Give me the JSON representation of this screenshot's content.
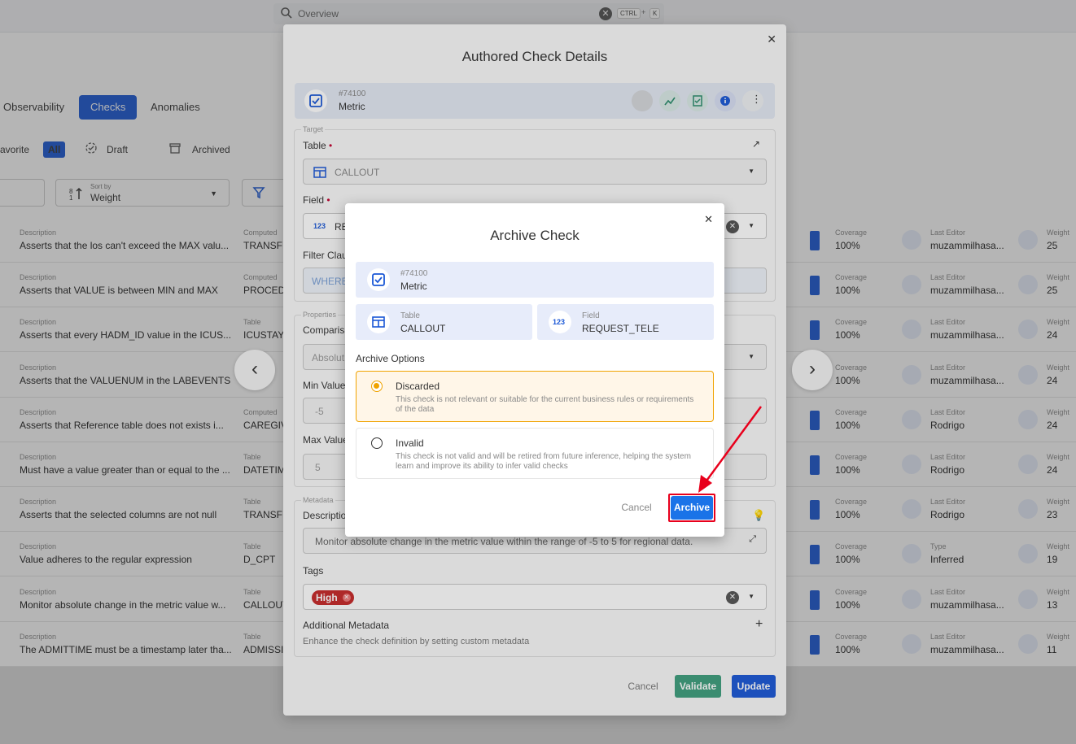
{
  "topbar": {
    "search_placeholder": "Overview",
    "kbd_ctrl": "CTRL",
    "kbd_plus": "+",
    "kbd_k": "K"
  },
  "tabs": {
    "observability": "Observability",
    "checks": "Checks",
    "anomalies": "Anomalies"
  },
  "filters": {
    "favorite": "avorite",
    "all": "All",
    "draft": "Draft",
    "archived": "Archived"
  },
  "sort": {
    "label": "Sort by",
    "value": "Weight"
  },
  "rows": [
    {
      "desc_label": "Description",
      "desc": "Asserts that the los can't exceed the MAX valu...",
      "col2_label": "Computed",
      "col2": "TRANSFE",
      "cov_label": "Coverage",
      "cov": "100%",
      "ed_label": "Last Editor",
      "editor": "muzammilhasa...",
      "w_label": "Weight",
      "weight": "25"
    },
    {
      "desc_label": "Description",
      "desc": "Asserts that VALUE is between MIN and MAX",
      "col2_label": "Computed",
      "col2": "PROCEDU",
      "cov_label": "Coverage",
      "cov": "100%",
      "ed_label": "Last Editor",
      "editor": "muzammilhasa...",
      "w_label": "Weight",
      "weight": "25"
    },
    {
      "desc_label": "Description",
      "desc": "Asserts that every HADM_ID value in the ICUS...",
      "col2_label": "Table",
      "col2": "ICUSTAYS",
      "cov_label": "Coverage",
      "cov": "100%",
      "ed_label": "Last Editor",
      "editor": "muzammilhasa...",
      "w_label": "Weight",
      "weight": "24"
    },
    {
      "desc_label": "Description",
      "desc": "Asserts that the VALUENUM in the LABEVENTS...",
      "col2_label": "",
      "col2": "EN",
      "cov_label": "Coverage",
      "cov": "100%",
      "ed_label": "Last Editor",
      "editor": "muzammilhasa...",
      "w_label": "Weight",
      "weight": "24"
    },
    {
      "desc_label": "Description",
      "desc": "Asserts that Reference table does not exists i...",
      "col2_label": "Computed",
      "col2": "CAREGIV",
      "cov_label": "Coverage",
      "cov": "100%",
      "ed_label": "Last Editor",
      "editor": "Rodrigo",
      "w_label": "Weight",
      "weight": "24"
    },
    {
      "desc_label": "Description",
      "desc": "Must have a value greater than or equal to the ...",
      "col2_label": "Table",
      "col2": "DATETIM",
      "cov_label": "Coverage",
      "cov": "100%",
      "ed_label": "Last Editor",
      "editor": "Rodrigo",
      "w_label": "Weight",
      "weight": "24"
    },
    {
      "desc_label": "Description",
      "desc": "Asserts that the selected columns are not null",
      "col2_label": "Table",
      "col2": "TRANSFE",
      "cov_label": "Coverage",
      "cov": "100%",
      "ed_label": "Last Editor",
      "editor": "Rodrigo",
      "w_label": "Weight",
      "weight": "23"
    },
    {
      "desc_label": "Description",
      "desc": "Value adheres to the regular expression",
      "col2_label": "Table",
      "col2": "D_CPT",
      "cov_label": "Coverage",
      "cov": "100%",
      "ed_label": "Type",
      "editor": "Inferred",
      "w_label": "Weight",
      "weight": "19"
    },
    {
      "desc_label": "Description",
      "desc": "Monitor absolute change in the metric value w...",
      "col2_label": "Table",
      "col2": "CALLOUT",
      "cov_label": "Coverage",
      "cov": "100%",
      "ed_label": "Last Editor",
      "editor": "muzammilhasa...",
      "w_label": "Weight",
      "weight": "13"
    },
    {
      "desc_label": "Description",
      "desc": "The ADMITTIME must be a timestamp later tha...",
      "col2_label": "Table",
      "col2": "ADMISSI",
      "cov_label": "Coverage",
      "cov": "100%",
      "ed_label": "Last Editor",
      "editor": "muzammilhasa...",
      "w_label": "Weight",
      "weight": "11"
    }
  ],
  "modal": {
    "title": "Authored Check Details",
    "check_id": "#74100",
    "check_type": "Metric",
    "target_section": "Target",
    "table_label": "Table",
    "table_value": "CALLOUT",
    "field_label": "Field",
    "field_value": "RE",
    "field_badge": "123",
    "filter_label": "Filter Clau",
    "filter_placeholder": "WHERE",
    "properties_section": "Properties",
    "comparison_label": "Comparis",
    "comparison_value": "Absolut",
    "min_label": "Min Value",
    "min_value": "-5",
    "max_label": "Max Value",
    "max_value": "5",
    "metadata_section": "Metadata",
    "description_label": "Descriptio",
    "description_value": "Monitor absolute change in the metric value within the range of -5 to 5 for regional data.",
    "tags_label": "Tags",
    "tag_high": "High",
    "additional_label": "Additional Metadata",
    "additional_desc": "Enhance the check definition by setting custom metadata",
    "cancel": "Cancel",
    "validate": "Validate",
    "update": "Update"
  },
  "dialog": {
    "title": "Archive Check",
    "check_id": "#74100",
    "check_type": "Metric",
    "table_label": "Table",
    "table_value": "CALLOUT",
    "field_label": "Field",
    "field_value": "REQUEST_TELE",
    "field_badge": "123",
    "options_label": "Archive Options",
    "opt1_title": "Discarded",
    "opt1_desc": "This check is not relevant or suitable for the current business rules or requirements of the data",
    "opt2_title": "Invalid",
    "opt2_desc": "This check is not valid and will be retired from future inference, helping the system learn and improve its ability to infer valid checks",
    "selected_option": "Discarded",
    "cancel": "Cancel",
    "archive": "Archive"
  },
  "colors": {
    "primary": "#1a57d6",
    "validate": "#3e9e7d",
    "archive": "#1a73e8",
    "highlight": "#e8001c",
    "discarded_bg": "#fff6e8",
    "discarded_border": "#f0a300",
    "tag_high": "#c62828"
  }
}
